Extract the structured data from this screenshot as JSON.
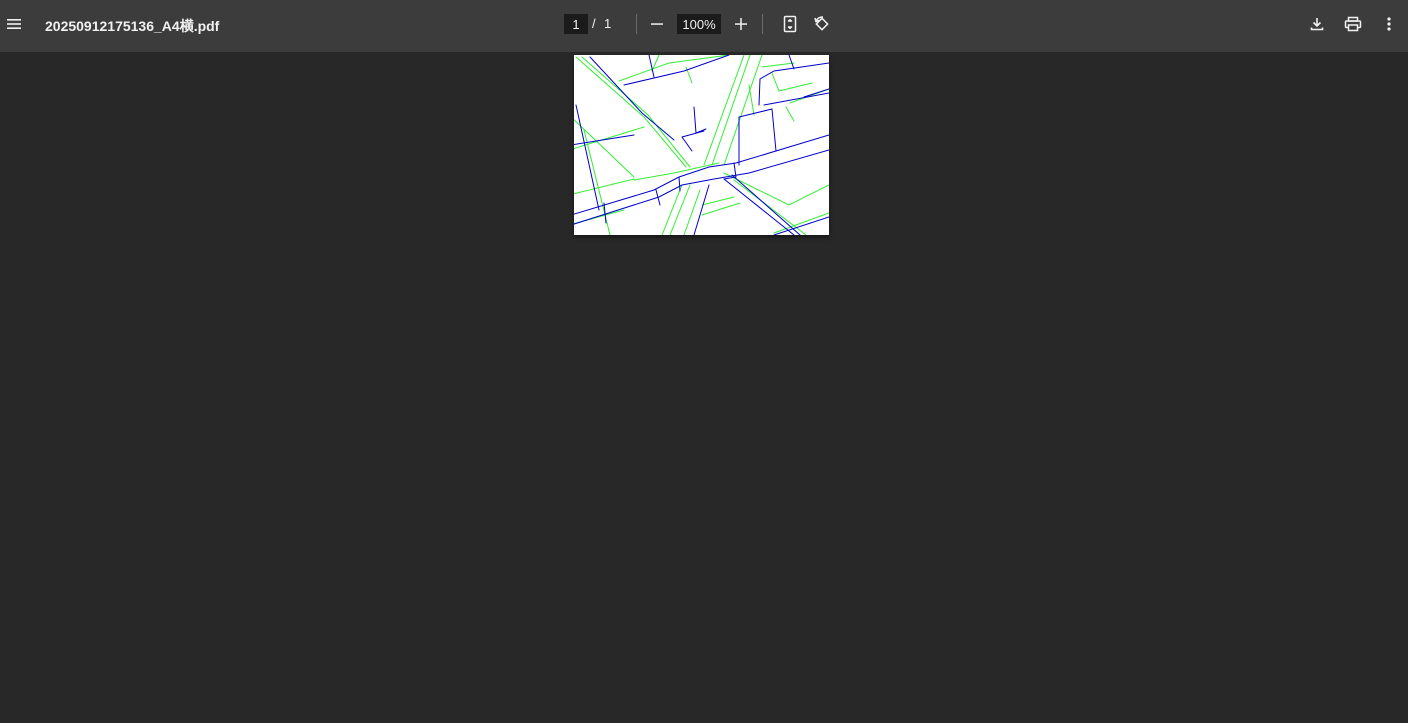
{
  "toolbar": {
    "title": "20250912175136_A4横.pdf",
    "page_current": "1",
    "page_separator": "/",
    "page_total": "1",
    "zoom": "100%",
    "icons": {
      "menu": "menu-icon",
      "zoom_out": "minus-icon",
      "zoom_in": "plus-icon",
      "fit": "fit-page-icon",
      "rotate": "rotate-icon",
      "download": "download-icon",
      "print": "print-icon",
      "more": "more-vert-icon"
    }
  },
  "colors": {
    "toolbar_bg": "#3c3c3c",
    "viewer_bg": "#282828",
    "map_blue": "#0000cc",
    "map_green": "#33ee33"
  }
}
